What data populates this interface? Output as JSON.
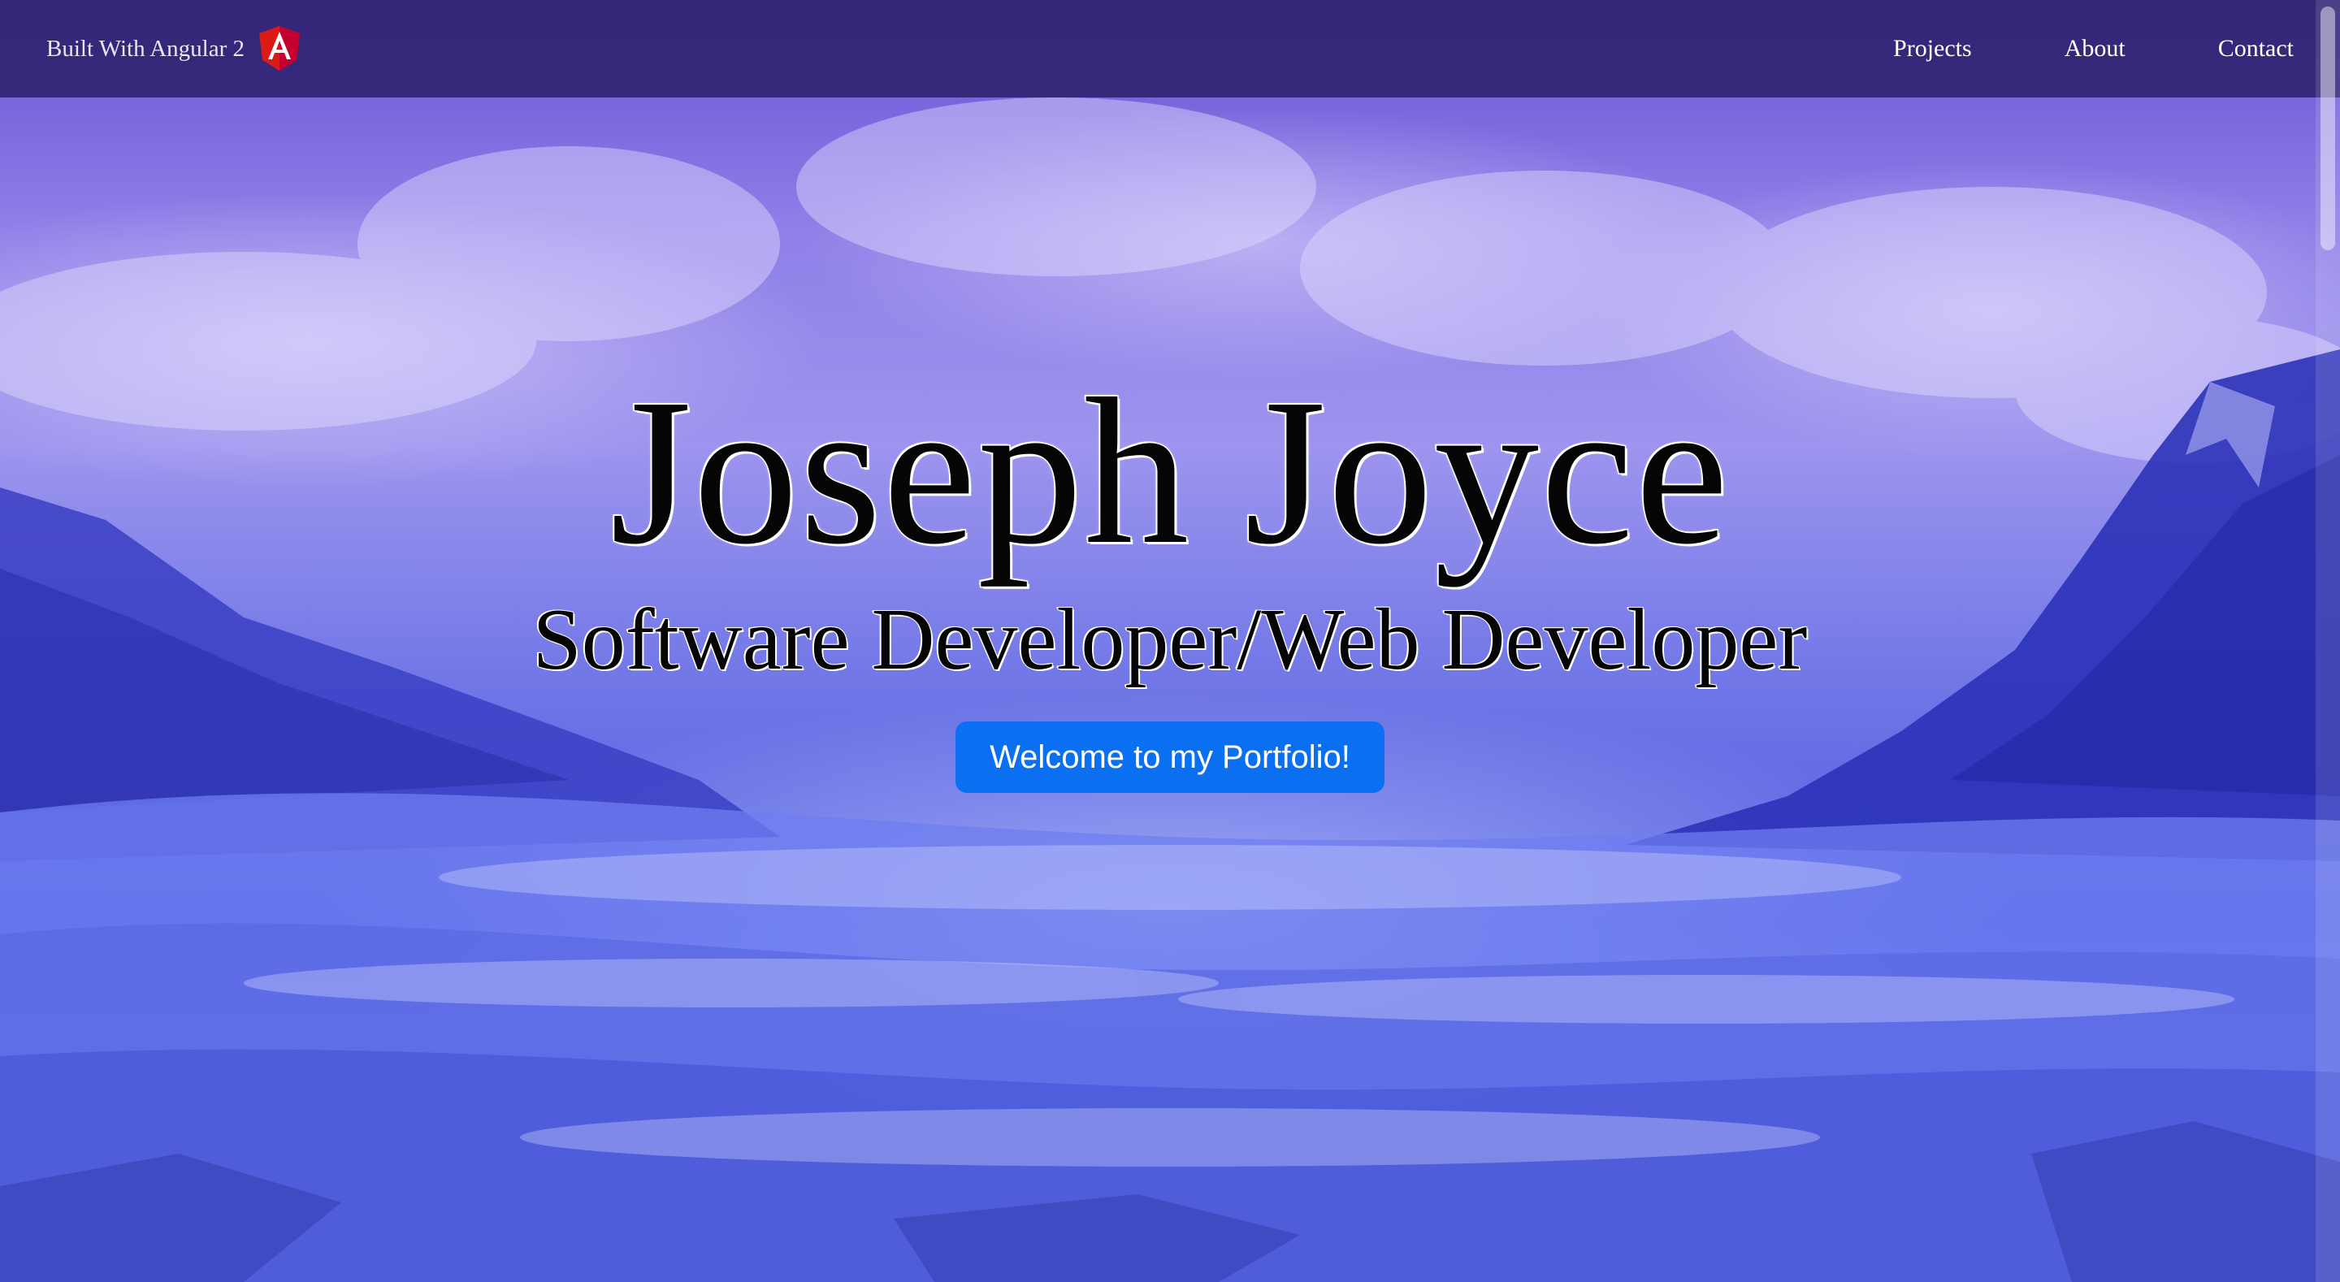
{
  "navbar": {
    "brand_text": "Built With Angular 2",
    "brand_icon": "angular-logo-icon",
    "links": [
      {
        "label": "Projects"
      },
      {
        "label": "About"
      },
      {
        "label": "Contact"
      }
    ]
  },
  "hero": {
    "title": "Joseph Joyce",
    "subtitle": "Software Developer/Web Developer",
    "button_label": "Welcome to my Portfolio!"
  },
  "colors": {
    "navbar_background": "#281c64",
    "button_background": "#0a6ff0",
    "angular_red": "#dd1b16",
    "sky_purple": "#8f80e8",
    "snow_blue": "#4d5bdf"
  }
}
